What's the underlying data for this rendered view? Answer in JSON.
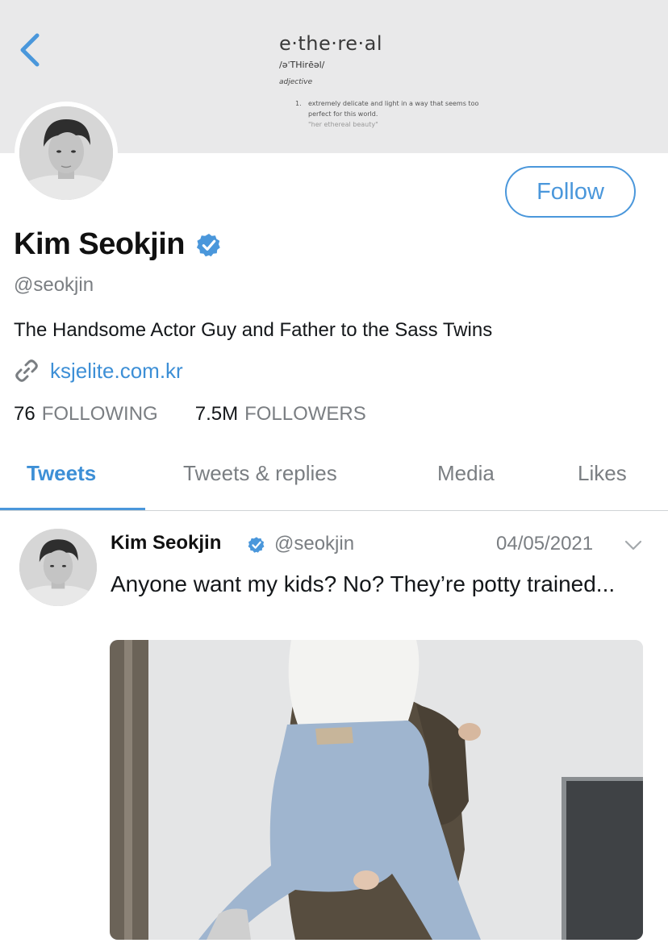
{
  "banner": {
    "dictionary": {
      "word": "e·the·re·al",
      "pronunciation": "/əˈTHirēəl/",
      "part_of_speech": "adjective",
      "definition_number": "1.",
      "definition": "extremely delicate and light in a way that seems too perfect for this world.",
      "example": "\"her ethereal beauty\""
    }
  },
  "nav": {
    "back_icon": "chevron-left-icon"
  },
  "profile": {
    "name": "Kim Seokjin",
    "handle": "@seokjin",
    "bio": "The Handsome Actor Guy and Father to the Sass Twins",
    "link": "ksjelite.com.kr",
    "following_count": "76",
    "following_label": "FOLLOWING",
    "followers_count": "7.5M",
    "followers_label": "FOLLOWERS",
    "follow_button": "Follow"
  },
  "tabs": [
    {
      "label": "Tweets",
      "active": true
    },
    {
      "label": "Tweets & replies",
      "active": false
    },
    {
      "label": "Media",
      "active": false
    },
    {
      "label": "Likes",
      "active": false
    }
  ],
  "tweet": {
    "name": "Kim Seokjin",
    "handle": "@seokjin",
    "date": "04/05/2021",
    "text": "Anyone want my kids? No? They’re potty trained..."
  },
  "colors": {
    "accent": "#4a97db",
    "link": "#3d8fd6",
    "muted": "#7a7e82",
    "banner_bg": "#e9e9ea"
  }
}
